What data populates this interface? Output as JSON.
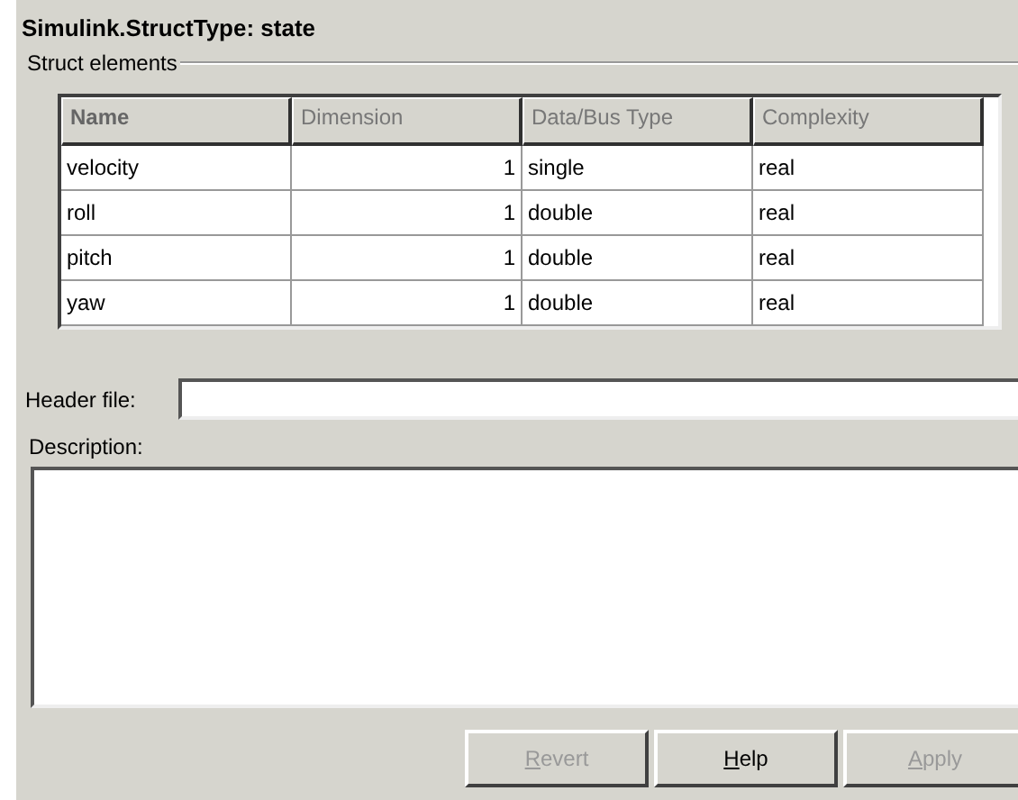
{
  "title": "Simulink.StructType: state",
  "group_label": "Struct elements",
  "table": {
    "columns": [
      {
        "label": "Name",
        "sorted": true,
        "kind": "text"
      },
      {
        "label": "Dimension",
        "sorted": false,
        "kind": "number"
      },
      {
        "label": "Data/Bus Type",
        "sorted": false,
        "kind": "text"
      },
      {
        "label": "Complexity",
        "sorted": false,
        "kind": "text"
      }
    ],
    "rows": [
      [
        "velocity",
        "1",
        "single",
        "real"
      ],
      [
        "roll",
        "1",
        "double",
        "real"
      ],
      [
        "pitch",
        "1",
        "double",
        "real"
      ],
      [
        "yaw",
        "1",
        "double",
        "real"
      ]
    ]
  },
  "header_file": {
    "label": "Header file:"
  },
  "description": {
    "label": "Description:"
  },
  "buttons": [
    {
      "label": "Revert",
      "disabled": true
    },
    {
      "label": "Help",
      "disabled": false
    },
    {
      "label": "Apply",
      "disabled": true
    }
  ]
}
